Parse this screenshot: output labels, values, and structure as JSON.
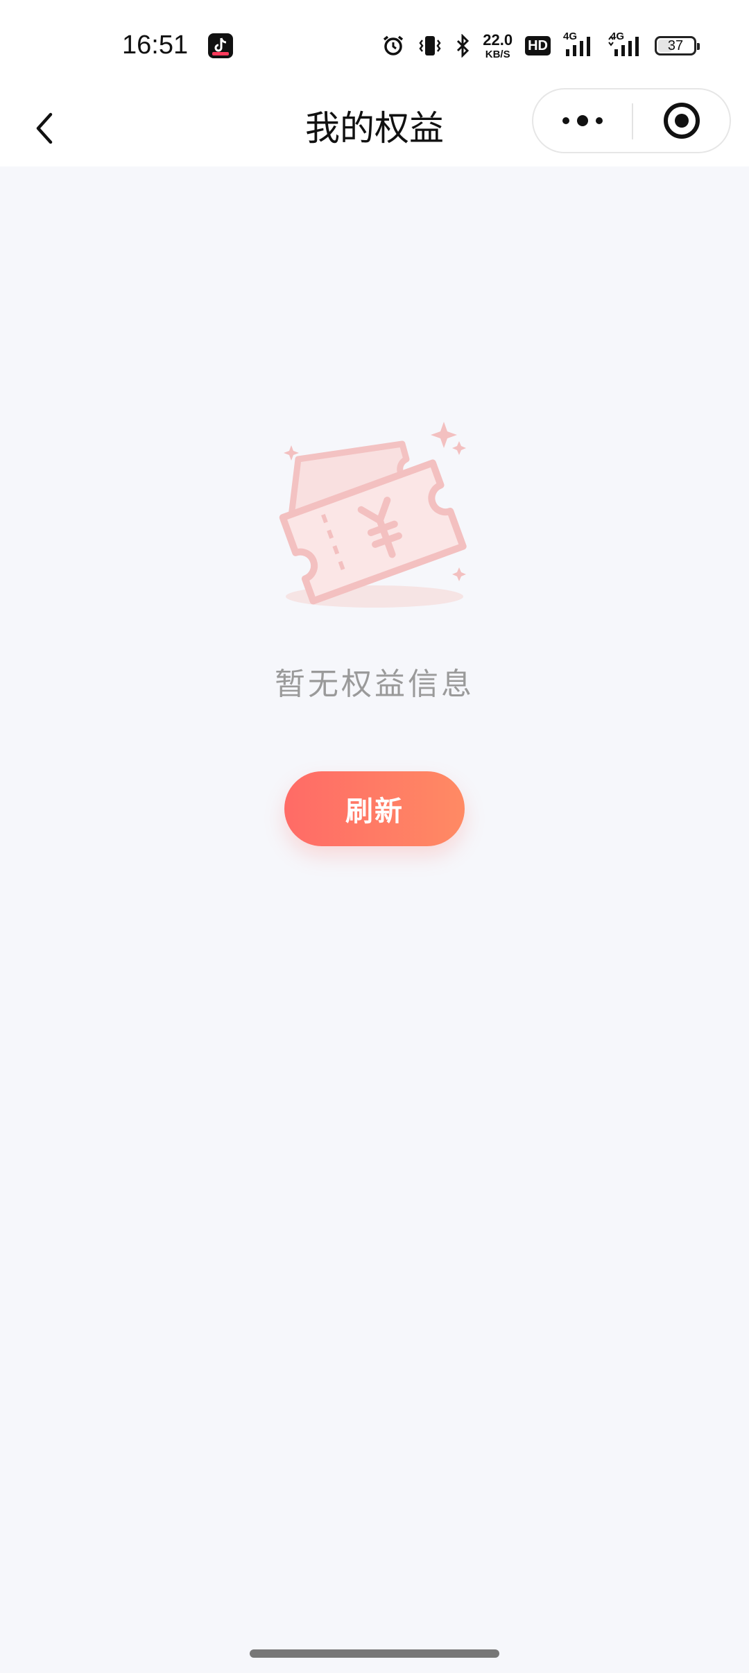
{
  "status_bar": {
    "time": "16:51",
    "net_speed_value": "22.0",
    "net_speed_unit": "KB/S",
    "hd_label": "HD",
    "signal_1_label": "4G",
    "signal_2_label": "4G",
    "battery_level": "37",
    "icons": [
      "douyin-app-icon",
      "alarm-icon",
      "vibrate-icon",
      "bluetooth-icon",
      "hd-icon",
      "signal-icon",
      "signal-icon",
      "battery-icon"
    ]
  },
  "nav": {
    "title": "我的权益",
    "back_icon": "chevron-left-icon",
    "more_icon": "more-dots-icon",
    "close_icon": "target-circle-icon"
  },
  "empty_state": {
    "illustration_icon": "ticket-coupon-icon",
    "message": "暂无权益信息",
    "refresh_label": "刷新"
  },
  "colors": {
    "background": "#f6f7fb",
    "accent_start": "#ff6b66",
    "accent_end": "#ff8a64",
    "muted_text": "#9a9a9a",
    "illustration": "#f4c4c4"
  }
}
